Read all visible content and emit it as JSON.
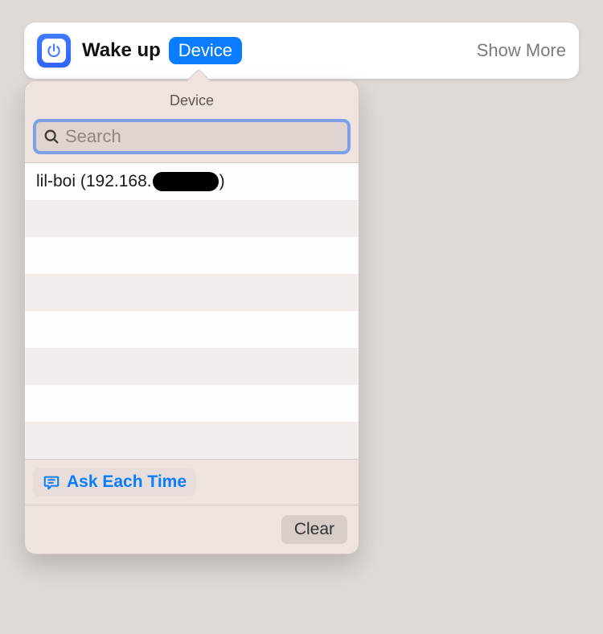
{
  "action": {
    "title": "Wake up",
    "token_label": "Device",
    "show_more_label": "Show More"
  },
  "popover": {
    "title": "Device",
    "search_placeholder": "Search",
    "search_value": "",
    "items": [
      {
        "label_prefix": "lil-boi (192.168.",
        "label_suffix": ")",
        "redacted": true
      }
    ],
    "ask_each_time_label": "Ask Each Time",
    "clear_label": "Clear"
  },
  "colors": {
    "accent": "#0a7cff",
    "focus_ring": "#7da0e8"
  }
}
